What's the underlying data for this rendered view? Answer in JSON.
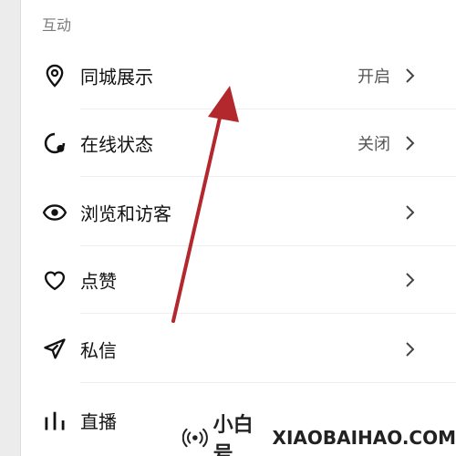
{
  "section_title": "互动",
  "items": [
    {
      "label": "同城展示",
      "value": "开启",
      "icon": "location-pin-icon"
    },
    {
      "label": "在线状态",
      "value": "关闭",
      "icon": "online-status-icon"
    },
    {
      "label": "浏览和访客",
      "value": "",
      "icon": "eye-icon"
    },
    {
      "label": "点赞",
      "value": "",
      "icon": "heart-icon"
    },
    {
      "label": "私信",
      "value": "",
      "icon": "paper-plane-icon"
    },
    {
      "label": "直播",
      "value": "",
      "icon": "bar-chart-icon"
    }
  ],
  "watermark": {
    "cn": "小白号",
    "en": "XIAOBAIHAO.COM"
  },
  "colors": {
    "arrow": "#b3282d",
    "text": "#111111",
    "muted": "#555555"
  }
}
